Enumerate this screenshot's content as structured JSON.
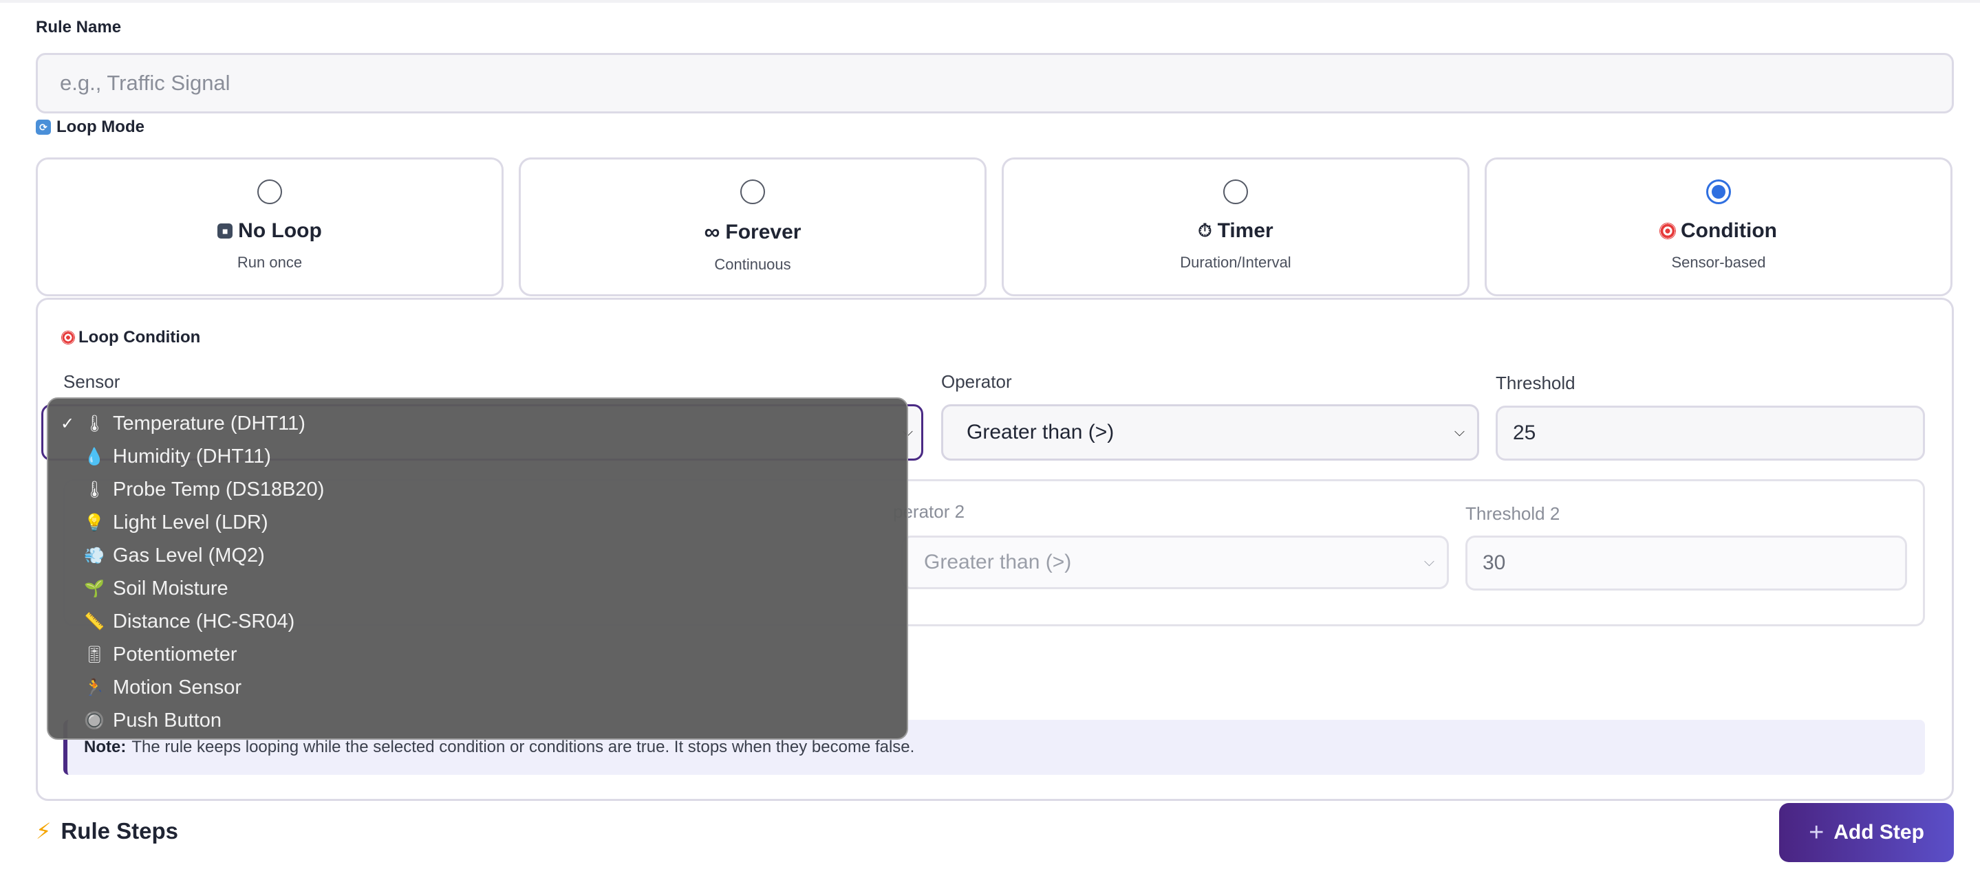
{
  "rule_name": {
    "label": "Rule Name",
    "placeholder": "e.g., Traffic Signal"
  },
  "loop_mode": {
    "label": "Loop Mode",
    "icon": "repeat-icon",
    "options": [
      {
        "title": "No Loop",
        "subtitle": "Run once",
        "icon": "stop-icon",
        "checked": false
      },
      {
        "title": "Forever",
        "subtitle": "Continuous",
        "icon": "infinity-icon",
        "checked": false
      },
      {
        "title": "Timer",
        "subtitle": "Duration/Interval",
        "icon": "stopwatch-icon",
        "checked": false
      },
      {
        "title": "Condition",
        "subtitle": "Sensor-based",
        "icon": "target-icon",
        "checked": true
      }
    ]
  },
  "loop_condition": {
    "title": "Loop Condition",
    "sensor_label": "Sensor",
    "operator_label": "Operator",
    "operator_value": "Greater than (>)",
    "threshold_label": "Threshold",
    "threshold_value": "25",
    "operator2_label": "perator 2",
    "operator2_value": "Greater than (>)",
    "threshold2_label": "Threshold 2",
    "threshold2_value": "30"
  },
  "sensor_dropdown": {
    "options": [
      {
        "label": "Temperature (DHT11)",
        "icon": "thermometer-icon",
        "glyph": "🌡",
        "selected": true
      },
      {
        "label": "Humidity (DHT11)",
        "icon": "droplet-icon",
        "glyph": "💧",
        "selected": false
      },
      {
        "label": "Probe Temp (DS18B20)",
        "icon": "thermometer-icon",
        "glyph": "🌡",
        "selected": false
      },
      {
        "label": "Light Level (LDR)",
        "icon": "lightbulb-icon",
        "glyph": "💡",
        "selected": false
      },
      {
        "label": "Gas Level (MQ2)",
        "icon": "gas-icon",
        "glyph": "💨",
        "selected": false
      },
      {
        "label": "Soil Moisture",
        "icon": "seedling-icon",
        "glyph": "🌱",
        "selected": false
      },
      {
        "label": "Distance (HC-SR04)",
        "icon": "ruler-icon",
        "glyph": "📏",
        "selected": false
      },
      {
        "label": "Potentiometer",
        "icon": "dial-icon",
        "glyph": "🎚",
        "selected": false
      },
      {
        "label": "Motion Sensor",
        "icon": "running-icon",
        "glyph": "🏃",
        "selected": false
      },
      {
        "label": "Push Button",
        "icon": "button-icon",
        "glyph": "🔘",
        "selected": false
      }
    ]
  },
  "note": {
    "prefix": "Note:",
    "text": "The rule keeps looping while the selected condition or conditions are true. It stops when they become false."
  },
  "rule_steps": {
    "title": "Rule Steps",
    "add_button": "Add Step"
  },
  "colors": {
    "accent": "#4a2a84",
    "radio_checked": "#2f6fe0",
    "button_start": "#4a2482",
    "button_end": "#5b4fc8"
  }
}
